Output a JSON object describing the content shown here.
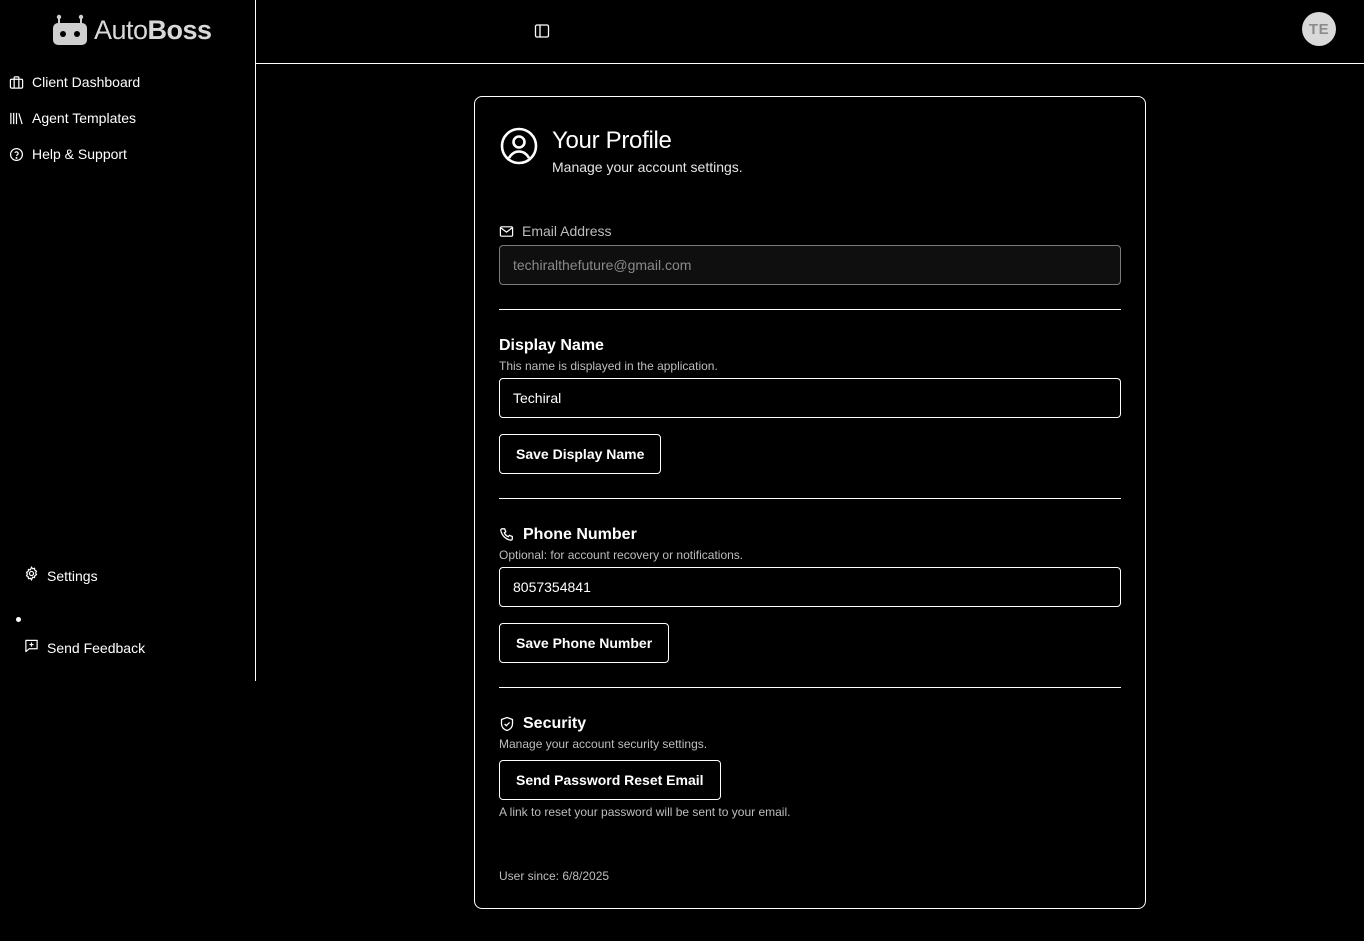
{
  "brand": {
    "name_light": "Auto",
    "name_bold": "Boss"
  },
  "sidebar": {
    "items": [
      {
        "label": "Client Dashboard",
        "icon": "briefcase-icon"
      },
      {
        "label": "Agent Templates",
        "icon": "library-icon"
      },
      {
        "label": "Help & Support",
        "icon": "help-circle-icon"
      }
    ],
    "bottom": [
      {
        "label": "Settings",
        "icon": "gear-icon"
      },
      {
        "label": "Send Feedback",
        "icon": "message-plus-icon"
      }
    ]
  },
  "header": {
    "toggle_icon": "sidebar-toggle-icon",
    "avatar_initials": "TE"
  },
  "profile": {
    "title": "Your Profile",
    "subtitle": "Manage your account settings.",
    "email": {
      "label": "Email Address",
      "value": "techiralthefuture@gmail.com"
    },
    "display_name": {
      "title": "Display Name",
      "hint": "This name is displayed in the application.",
      "value": "Techiral",
      "button": "Save Display Name"
    },
    "phone": {
      "title": "Phone Number",
      "hint": "Optional: for account recovery or notifications.",
      "value": "8057354841",
      "button": "Save Phone Number"
    },
    "security": {
      "title": "Security",
      "hint": "Manage your account security settings.",
      "button": "Send Password Reset Email",
      "note": "A link to reset your password will be sent to your email."
    },
    "user_since": "User since: 6/8/2025"
  },
  "colors": {
    "background": "#000000",
    "foreground": "#ffffff",
    "muted": "#bdbdbd",
    "avatar_bg": "#d9d9d9"
  }
}
